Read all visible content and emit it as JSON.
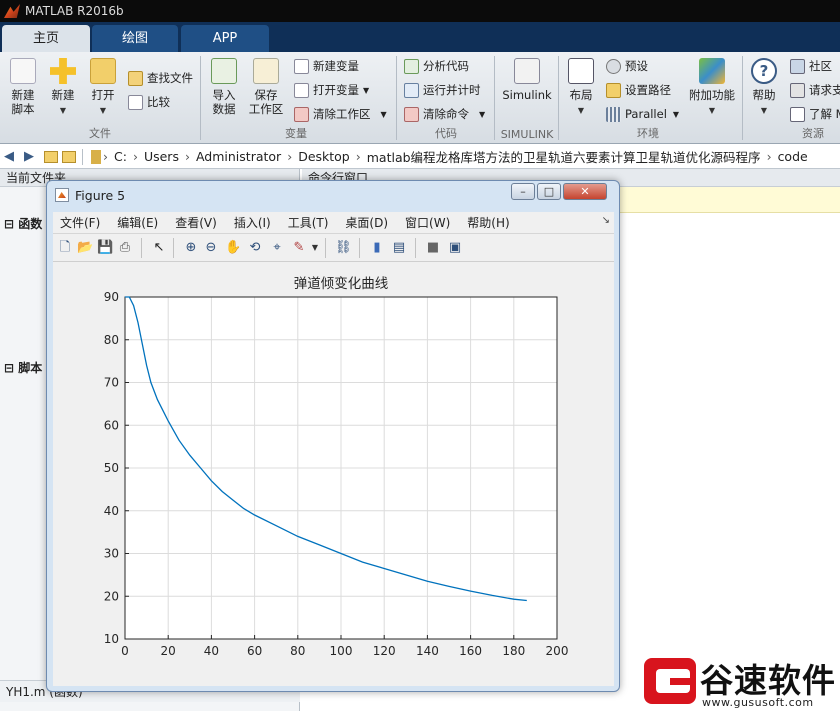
{
  "app": {
    "title": "MATLAB R2016b"
  },
  "tabs": [
    "主页",
    "绘图",
    "APP"
  ],
  "ribbon": {
    "file_group": {
      "new_script": "新建\n脚本",
      "new": "新建",
      "open": "打开",
      "find_files": "查找文件",
      "compare": "比较",
      "label": "文件"
    },
    "var_group": {
      "import": "导入\n数据",
      "save_ws": "保存\n工作区",
      "new_var": "新建变量",
      "open_var": "打开变量",
      "clear_ws": "清除工作区",
      "label": "变量"
    },
    "code_group": {
      "analyze": "分析代码",
      "run_time": "运行并计时",
      "clear_cmd": "清除命令",
      "label": "代码"
    },
    "simulink_group": {
      "simulink": "Simulink",
      "label": "SIMULINK"
    },
    "env_group": {
      "layout": "布局",
      "prefs": "预设",
      "set_path": "设置路径",
      "parallel": "Parallel",
      "addons": "附加功能",
      "label": "环境"
    },
    "res_group": {
      "help": "帮助",
      "community": "社区",
      "request": "请求支",
      "learn": "了解 M",
      "label": "资源"
    }
  },
  "address": {
    "crumbs": [
      "C:",
      "Users",
      "Administrator",
      "Desktop",
      "matlab编程龙格库塔方法的卫星轨道六要素计算卫星轨道优化源码程序",
      "code"
    ]
  },
  "panels": {
    "current_folder": "当前文件夹",
    "command_window": "命令行窗口",
    "functions_label": "函数",
    "scripts_label": "脚本",
    "bottom_file": "YH1.m  (函数)"
  },
  "figure": {
    "title": "Figure 5",
    "menu": [
      "文件(F)",
      "编辑(E)",
      "查看(V)",
      "插入(I)",
      "工具(T)",
      "桌面(D)",
      "窗口(W)",
      "帮助(H)"
    ]
  },
  "chart_data": {
    "type": "line",
    "title": "弹道倾变化曲线",
    "xlabel": "",
    "ylabel": "",
    "xlim": [
      0,
      200
    ],
    "ylim": [
      10,
      90
    ],
    "xticks": [
      0,
      20,
      40,
      60,
      80,
      100,
      120,
      140,
      160,
      180,
      200
    ],
    "yticks": [
      10,
      20,
      30,
      40,
      50,
      60,
      70,
      80,
      90
    ],
    "grid": true,
    "line_color": "#0072bd",
    "x": [
      0,
      2,
      4,
      6,
      8,
      10,
      12,
      15,
      18,
      20,
      25,
      30,
      35,
      40,
      45,
      50,
      55,
      60,
      70,
      80,
      90,
      100,
      110,
      120,
      130,
      140,
      150,
      160,
      170,
      180,
      186
    ],
    "y": [
      90,
      90,
      88,
      84,
      79,
      74,
      70,
      66,
      63,
      61,
      56.5,
      53,
      50,
      47,
      44.5,
      42.5,
      40.5,
      39,
      36.5,
      34,
      32,
      30,
      28,
      26.5,
      25,
      23.5,
      22.3,
      21.2,
      20.2,
      19.3,
      19
    ]
  },
  "watermark": {
    "name": "谷速软件",
    "url": "www.gususoft.com"
  }
}
